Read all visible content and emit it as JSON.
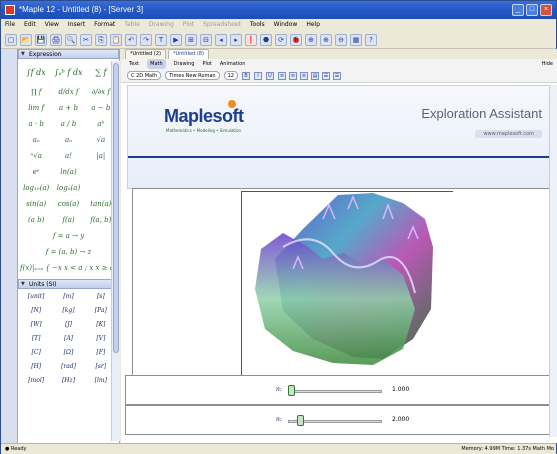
{
  "window": {
    "title": "*Maple 12 - Untitled (8) - [Server 3]"
  },
  "menu": [
    "File",
    "Edit",
    "View",
    "Insert",
    "Format",
    "Table",
    "Drawing",
    "Plot",
    "Spreadsheet",
    "Tools",
    "Window",
    "Help"
  ],
  "menu_disabled": [
    "Table",
    "Drawing",
    "Plot",
    "Spreadsheet"
  ],
  "toolbar": {
    "icons": [
      "new-icon",
      "open-icon",
      "save-icon",
      "print-icon",
      "print-preview-icon",
      "cut-icon",
      "copy-icon",
      "paste-icon",
      "undo-icon",
      "redo-icon",
      "text-mode-icon",
      "prompt-icon",
      "table-icon",
      "section-icon",
      "back-icon",
      "forward-icon",
      "execute-icon",
      "stop-icon",
      "restart-icon",
      "debug-icon",
      "zoom-icon",
      "zoom-in-icon",
      "zoom-out-icon",
      "grid-icon",
      "help-icon"
    ],
    "glyphs": [
      "▢",
      "📂",
      "💾",
      "🖨",
      "🔍",
      "✂",
      "⎘",
      "📋",
      "↶",
      "↷",
      "T",
      "▶",
      "⊞",
      "⊟",
      "◂",
      "▸",
      "❗",
      "⬣",
      "⟳",
      "🐞",
      "⊕",
      "⊕",
      "⊖",
      "▦",
      "?"
    ]
  },
  "palette": {
    "expression_title": "Expression",
    "expressions": [
      "∫f dx",
      "∫ₐᵇ f dx",
      "∑ f",
      "∏ f",
      "d/dx f",
      "∂/∂x f",
      "lim f",
      "a + b",
      "a − b",
      "a · b",
      "a / b",
      "aᵇ",
      "aₙ",
      "aₙ",
      "√a",
      "ⁿ√a",
      "a!",
      "|a|",
      "eᵃ",
      "ln(a)",
      "",
      "log₁₀(a)",
      "logₙ(a)",
      "",
      "sin(a)",
      "cos(a)",
      "tan(a)",
      "(a b)",
      "f(a)",
      "f(a, b)"
    ],
    "expr_wide": [
      "f = a → y",
      "f = (a, b) → z",
      "f(x)|ₓ₌ₐ    { −x  x < a ;  x  x ≥ a }"
    ],
    "units_title": "Units (SI)",
    "units": [
      "[unit]",
      "[m]",
      "[s]",
      "[N]",
      "[kg]",
      "[Pa]",
      "[W]",
      "[J]",
      "[K]",
      "[T]",
      "[A]",
      "[V]",
      "[C]",
      "[Ω]",
      "[F]",
      "[H]",
      "[rad]",
      "[sr]",
      "[mol]",
      "[Hz]",
      "[lm]"
    ]
  },
  "tabs": [
    {
      "label": "*Untitled (2)"
    },
    {
      "label": "*Untitled (8)",
      "active": true
    }
  ],
  "modes": [
    "Text",
    "Math",
    "Drawing",
    "Plot",
    "Animation"
  ],
  "mode_active": "Math",
  "mode_right": "Hide",
  "format": {
    "style": "C 2D Math",
    "font": "Times New Roman",
    "size": "12",
    "buttons": [
      "B",
      "I",
      "U"
    ],
    "align_icons": [
      "align-left-icon",
      "align-center-icon",
      "align-right-icon",
      "indent-icon",
      "list-icon",
      "numbered-list-icon"
    ],
    "align_glyphs": [
      "≡",
      "≡",
      "≡",
      "▤",
      "☰",
      "☰"
    ]
  },
  "banner": {
    "logo": "Maplesoft",
    "logo_sub": "Mathematics • Modeling • Simulation",
    "title": "Exploration Assistant",
    "url": "www.maplesoft.com"
  },
  "sliders": [
    {
      "label": "n:",
      "value": "1.000",
      "fraction": 0.0
    },
    {
      "label": "n:",
      "value": "2.000",
      "fraction": 0.1
    }
  ],
  "status": {
    "ready": "Ready",
    "right": "Memory: 4.99M   Time: 1.37s   Math Mo"
  },
  "colors": {
    "title_bar": "#2357c4",
    "accent": "#1d3f8f",
    "surface_min": "#2f6b3a",
    "surface_mid": "#4da3c7",
    "surface_max": "#b74fb2"
  }
}
